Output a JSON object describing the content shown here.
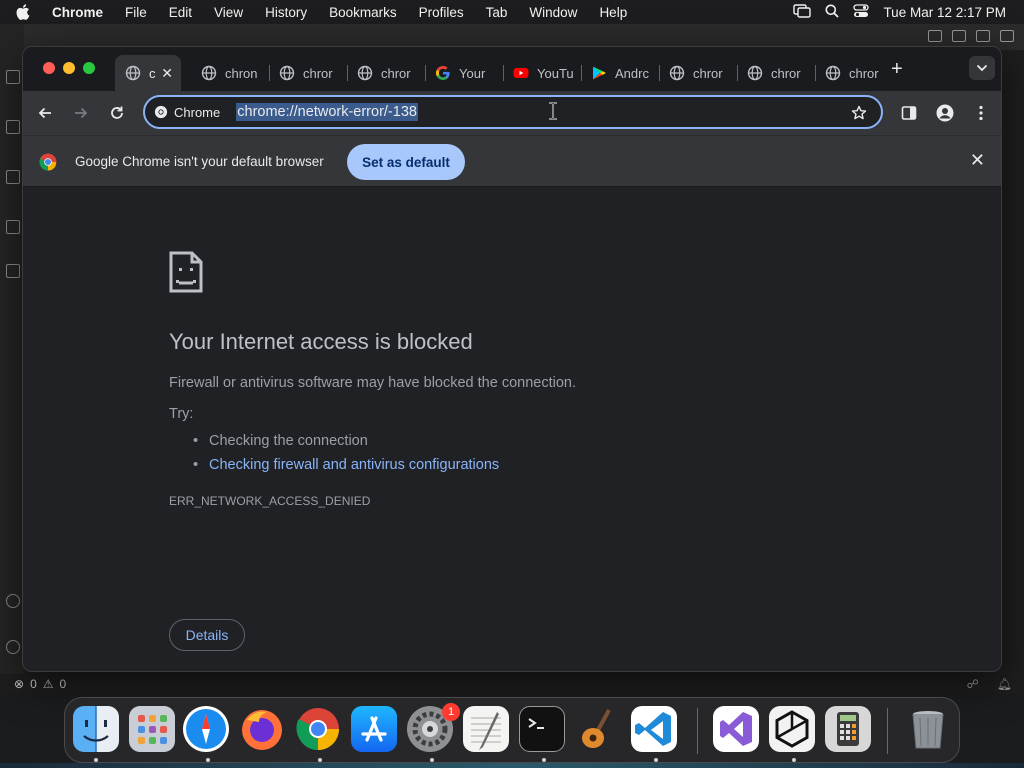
{
  "menubar": {
    "app_name": "Chrome",
    "items": [
      "File",
      "Edit",
      "View",
      "History",
      "Bookmarks",
      "Profiles",
      "Tab",
      "Window",
      "Help"
    ],
    "clock": "Tue Mar 12  2:17 PM",
    "icons": [
      "screen-mirroring-icon",
      "spotlight-search-icon",
      "control-center-icon"
    ]
  },
  "tabs": [
    {
      "title": "c",
      "icon": "globe-icon",
      "active": true
    },
    {
      "title": "chron",
      "icon": "globe-icon"
    },
    {
      "title": "chror",
      "icon": "globe-icon"
    },
    {
      "title": "chror",
      "icon": "globe-icon"
    },
    {
      "title": "Your",
      "icon": "google-icon"
    },
    {
      "title": "YouTu",
      "icon": "youtube-icon"
    },
    {
      "title": "Andrc",
      "icon": "play-store-icon"
    },
    {
      "title": "chror",
      "icon": "globe-icon"
    },
    {
      "title": "chror",
      "icon": "globe-icon"
    },
    {
      "title": "chror",
      "icon": "globe-icon"
    }
  ],
  "toolbar": {
    "chip_label": "Chrome",
    "url": "chrome://network-error/-138"
  },
  "infobar": {
    "message": "Google Chrome isn't your default browser",
    "button": "Set as default"
  },
  "error": {
    "title": "Your Internet access is blocked",
    "description": "Firewall or antivirus software may have blocked the connection.",
    "try_label": "Try:",
    "suggestions": [
      "Checking the connection",
      "Checking firewall and antivirus configurations"
    ],
    "code": "ERR_NETWORK_ACCESS_DENIED",
    "details_button": "Details"
  },
  "statusbar": {
    "errors": "0",
    "warnings": "0"
  },
  "dock": {
    "apps": [
      "Finder",
      "Launchpad",
      "Safari",
      "Firefox",
      "Chrome",
      "App Store",
      "System Settings",
      "TextEdit",
      "Terminal",
      "GarageBand",
      "Visual Studio Code",
      "Visual Studio",
      "Cursor",
      "Calculator",
      "Trash"
    ],
    "system_settings_badge": "1"
  },
  "colors": {
    "accent": "#8ab4f8",
    "set_default_bg": "#a8c7fa",
    "window_bg": "#202124",
    "toolbar_bg": "#35363a"
  }
}
